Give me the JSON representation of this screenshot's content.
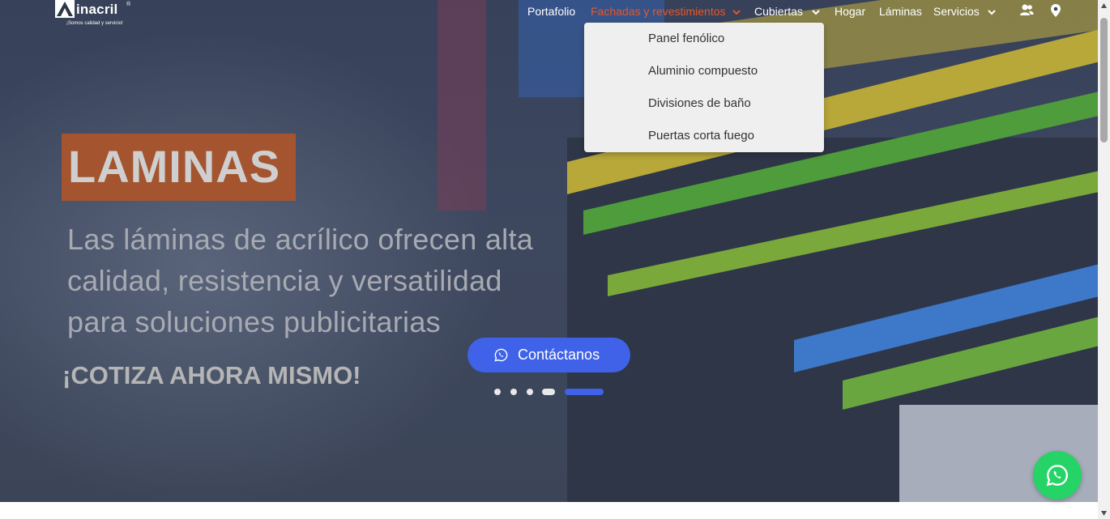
{
  "brand": {
    "name": "inacril",
    "registered": "®",
    "tagline": "¡Somos calidad y servicio!"
  },
  "nav": {
    "items": [
      {
        "label": "Portafolio"
      },
      {
        "label": "Fachadas y revestimientos",
        "has_dropdown": true,
        "active": true
      },
      {
        "label": "Cubiertas",
        "has_dropdown": true
      },
      {
        "label": "Hogar"
      },
      {
        "label": "Láminas"
      },
      {
        "label": "Servicios",
        "has_dropdown": true
      }
    ],
    "icons": [
      "users-icon",
      "location-pin-icon"
    ]
  },
  "dropdown": {
    "items": [
      {
        "label": "Panel fenólico"
      },
      {
        "label": "Aluminio compuesto"
      },
      {
        "label": "Divisiones de baño"
      },
      {
        "label": "Puertas corta fuego"
      }
    ]
  },
  "hero": {
    "badge": "LAMINAS",
    "lines": [
      "Las láminas de acrílico ofrecen alta",
      "calidad, resistencia y versatilidad",
      "para soluciones publicitarias"
    ],
    "cta_text": "¡COTIZA AHORA MISMO!",
    "button_label": "Contáctanos",
    "slides_total": 5,
    "active_slide": 5
  },
  "colors": {
    "accent": "#e4572e",
    "button": "#3f62e8",
    "whatsapp": "#25d366",
    "badge": "#a4552f"
  },
  "floating": {
    "icon": "whatsapp-icon"
  }
}
